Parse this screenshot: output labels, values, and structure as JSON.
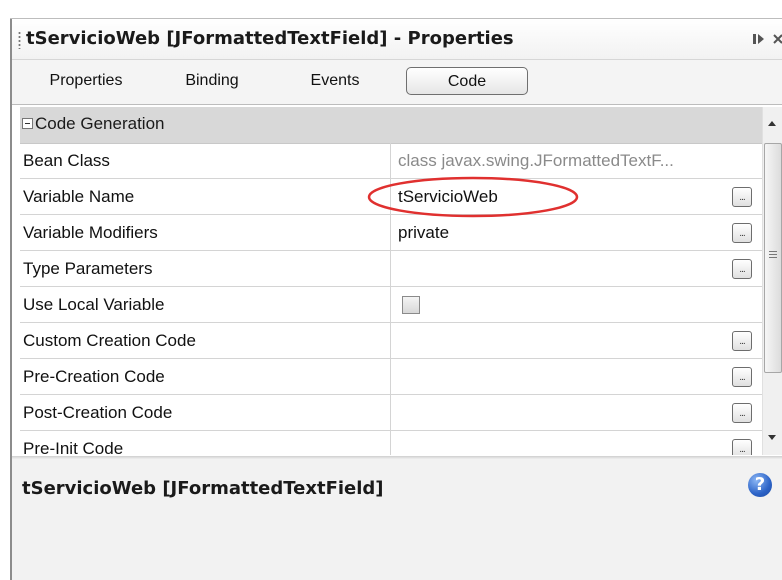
{
  "window": {
    "title": "tServicioWeb [JFormattedTextField] - Properties",
    "maximize_icon": "maximize-icon",
    "close_icon": "close-icon"
  },
  "tabs": [
    {
      "label": "Properties",
      "active": false
    },
    {
      "label": "Binding",
      "active": false
    },
    {
      "label": "Events",
      "active": false
    },
    {
      "label": "Code",
      "active": true
    }
  ],
  "category": {
    "label": "Code Generation",
    "expanded": true
  },
  "properties": [
    {
      "name": "Bean Class",
      "value": "class javax.swing.JFormattedTextF...",
      "readonly": true,
      "editor": "none"
    },
    {
      "name": "Variable Name",
      "value": "tServicioWeb",
      "readonly": false,
      "editor": "ellipsis",
      "highlighted": true
    },
    {
      "name": "Variable Modifiers",
      "value": "private",
      "readonly": false,
      "editor": "ellipsis"
    },
    {
      "name": "Type Parameters",
      "value": "",
      "readonly": false,
      "editor": "ellipsis"
    },
    {
      "name": "Use Local Variable",
      "value": "",
      "readonly": false,
      "editor": "checkbox",
      "checked": false
    },
    {
      "name": "Custom Creation Code",
      "value": "",
      "readonly": false,
      "editor": "ellipsis"
    },
    {
      "name": "Pre-Creation Code",
      "value": "",
      "readonly": false,
      "editor": "ellipsis"
    },
    {
      "name": "Post-Creation Code",
      "value": "",
      "readonly": false,
      "editor": "ellipsis"
    },
    {
      "name": "Pre-Init Code",
      "value": "",
      "readonly": false,
      "editor": "ellipsis"
    }
  ],
  "ellipsis_label": "...",
  "description": {
    "title": "tServicioWeb [JFormattedTextField]",
    "help_glyph": "?"
  },
  "colors": {
    "highlight": "#e0302f",
    "category_bg": "#d8d8d8",
    "help_blue": "#2c63c7"
  }
}
